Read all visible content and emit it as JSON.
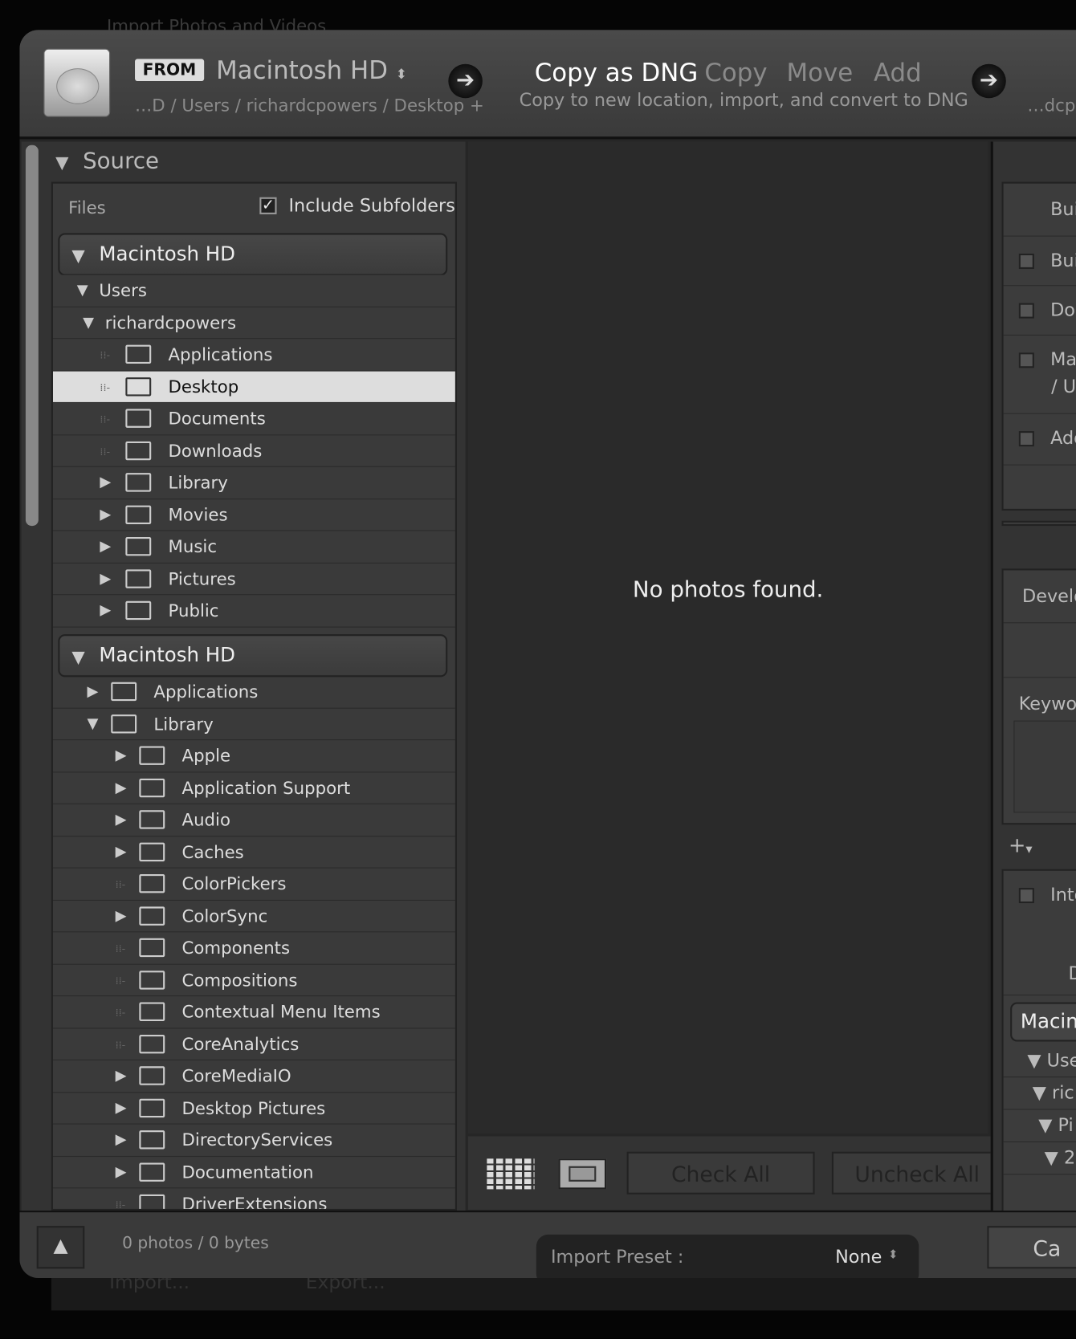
{
  "background": {
    "title": "Import Photos and Videos",
    "bottom_buttons": [
      "Import...",
      "Export..."
    ]
  },
  "header": {
    "from_badge": "FROM",
    "source_name": "Macintosh HD",
    "source_path": "…D / Users / richardcpowers / Desktop +",
    "modes": [
      "Copy as DNG",
      "Copy",
      "Move",
      "Add"
    ],
    "active_mode": "Copy as DNG",
    "mode_description": "Copy to new location, import, and convert to DNG",
    "destination_path": "…dcp"
  },
  "source": {
    "title": "Source",
    "files_label": "Files",
    "include_subfolders": "Include Subfolders",
    "include_subfolders_checked": true,
    "volume1": {
      "name": "Macintosh HD",
      "rows": [
        {
          "label": "Users",
          "level": 0,
          "state": "open"
        },
        {
          "label": "richardcpowers",
          "level": 1,
          "state": "open"
        },
        {
          "label": "Applications",
          "level": 2,
          "state": "none",
          "folder": true
        },
        {
          "label": "Desktop",
          "level": 2,
          "state": "none",
          "folder": true,
          "selected": true
        },
        {
          "label": "Documents",
          "level": 2,
          "state": "none",
          "folder": true
        },
        {
          "label": "Downloads",
          "level": 2,
          "state": "none",
          "folder": true
        },
        {
          "label": "Library",
          "level": 2,
          "state": "closed",
          "folder": true
        },
        {
          "label": "Movies",
          "level": 2,
          "state": "closed",
          "folder": true
        },
        {
          "label": "Music",
          "level": 2,
          "state": "closed",
          "folder": true
        },
        {
          "label": "Pictures",
          "level": 2,
          "state": "closed",
          "folder": true
        },
        {
          "label": "Public",
          "level": 2,
          "state": "closed",
          "folder": true
        }
      ]
    },
    "volume2": {
      "name": "Macintosh HD",
      "rows": [
        {
          "label": "Applications",
          "level": 0,
          "state": "closed"
        },
        {
          "label": "Library",
          "level": 0,
          "state": "open"
        },
        {
          "label": "Apple",
          "level": 1,
          "state": "closed"
        },
        {
          "label": "Application Support",
          "level": 1,
          "state": "closed"
        },
        {
          "label": "Audio",
          "level": 1,
          "state": "closed"
        },
        {
          "label": "Caches",
          "level": 1,
          "state": "closed"
        },
        {
          "label": "ColorPickers",
          "level": 1,
          "state": "none"
        },
        {
          "label": "ColorSync",
          "level": 1,
          "state": "closed"
        },
        {
          "label": "Components",
          "level": 1,
          "state": "none"
        },
        {
          "label": "Compositions",
          "level": 1,
          "state": "none"
        },
        {
          "label": "Contextual Menu Items",
          "level": 1,
          "state": "none"
        },
        {
          "label": "CoreAnalytics",
          "level": 1,
          "state": "none"
        },
        {
          "label": "CoreMediaIO",
          "level": 1,
          "state": "closed"
        },
        {
          "label": "Desktop Pictures",
          "level": 1,
          "state": "closed"
        },
        {
          "label": "DirectoryServices",
          "level": 1,
          "state": "closed"
        },
        {
          "label": "Documentation",
          "level": 1,
          "state": "closed"
        },
        {
          "label": "DriverExtensions",
          "level": 1,
          "state": "none"
        }
      ]
    }
  },
  "center": {
    "empty_message": "No photos found.",
    "check_all": "Check All",
    "uncheck_all": "Uncheck All"
  },
  "right": {
    "panel1_header": "Bui",
    "panel1_rows": [
      "Buil",
      "Dor",
      "Mal",
      "Add"
    ],
    "panel1_row3_sub": "/ Us",
    "develop": "Develo",
    "keywords": "Keywor",
    "into": "Into",
    "d_label": "D",
    "dest_volume": "Macint",
    "dest_rows": [
      "Use",
      "ric",
      "Pi",
      "2"
    ]
  },
  "footer": {
    "count": "0 photos / 0 bytes",
    "preset_label": "Import Preset :",
    "preset_value": "None",
    "cancel": "Ca"
  }
}
